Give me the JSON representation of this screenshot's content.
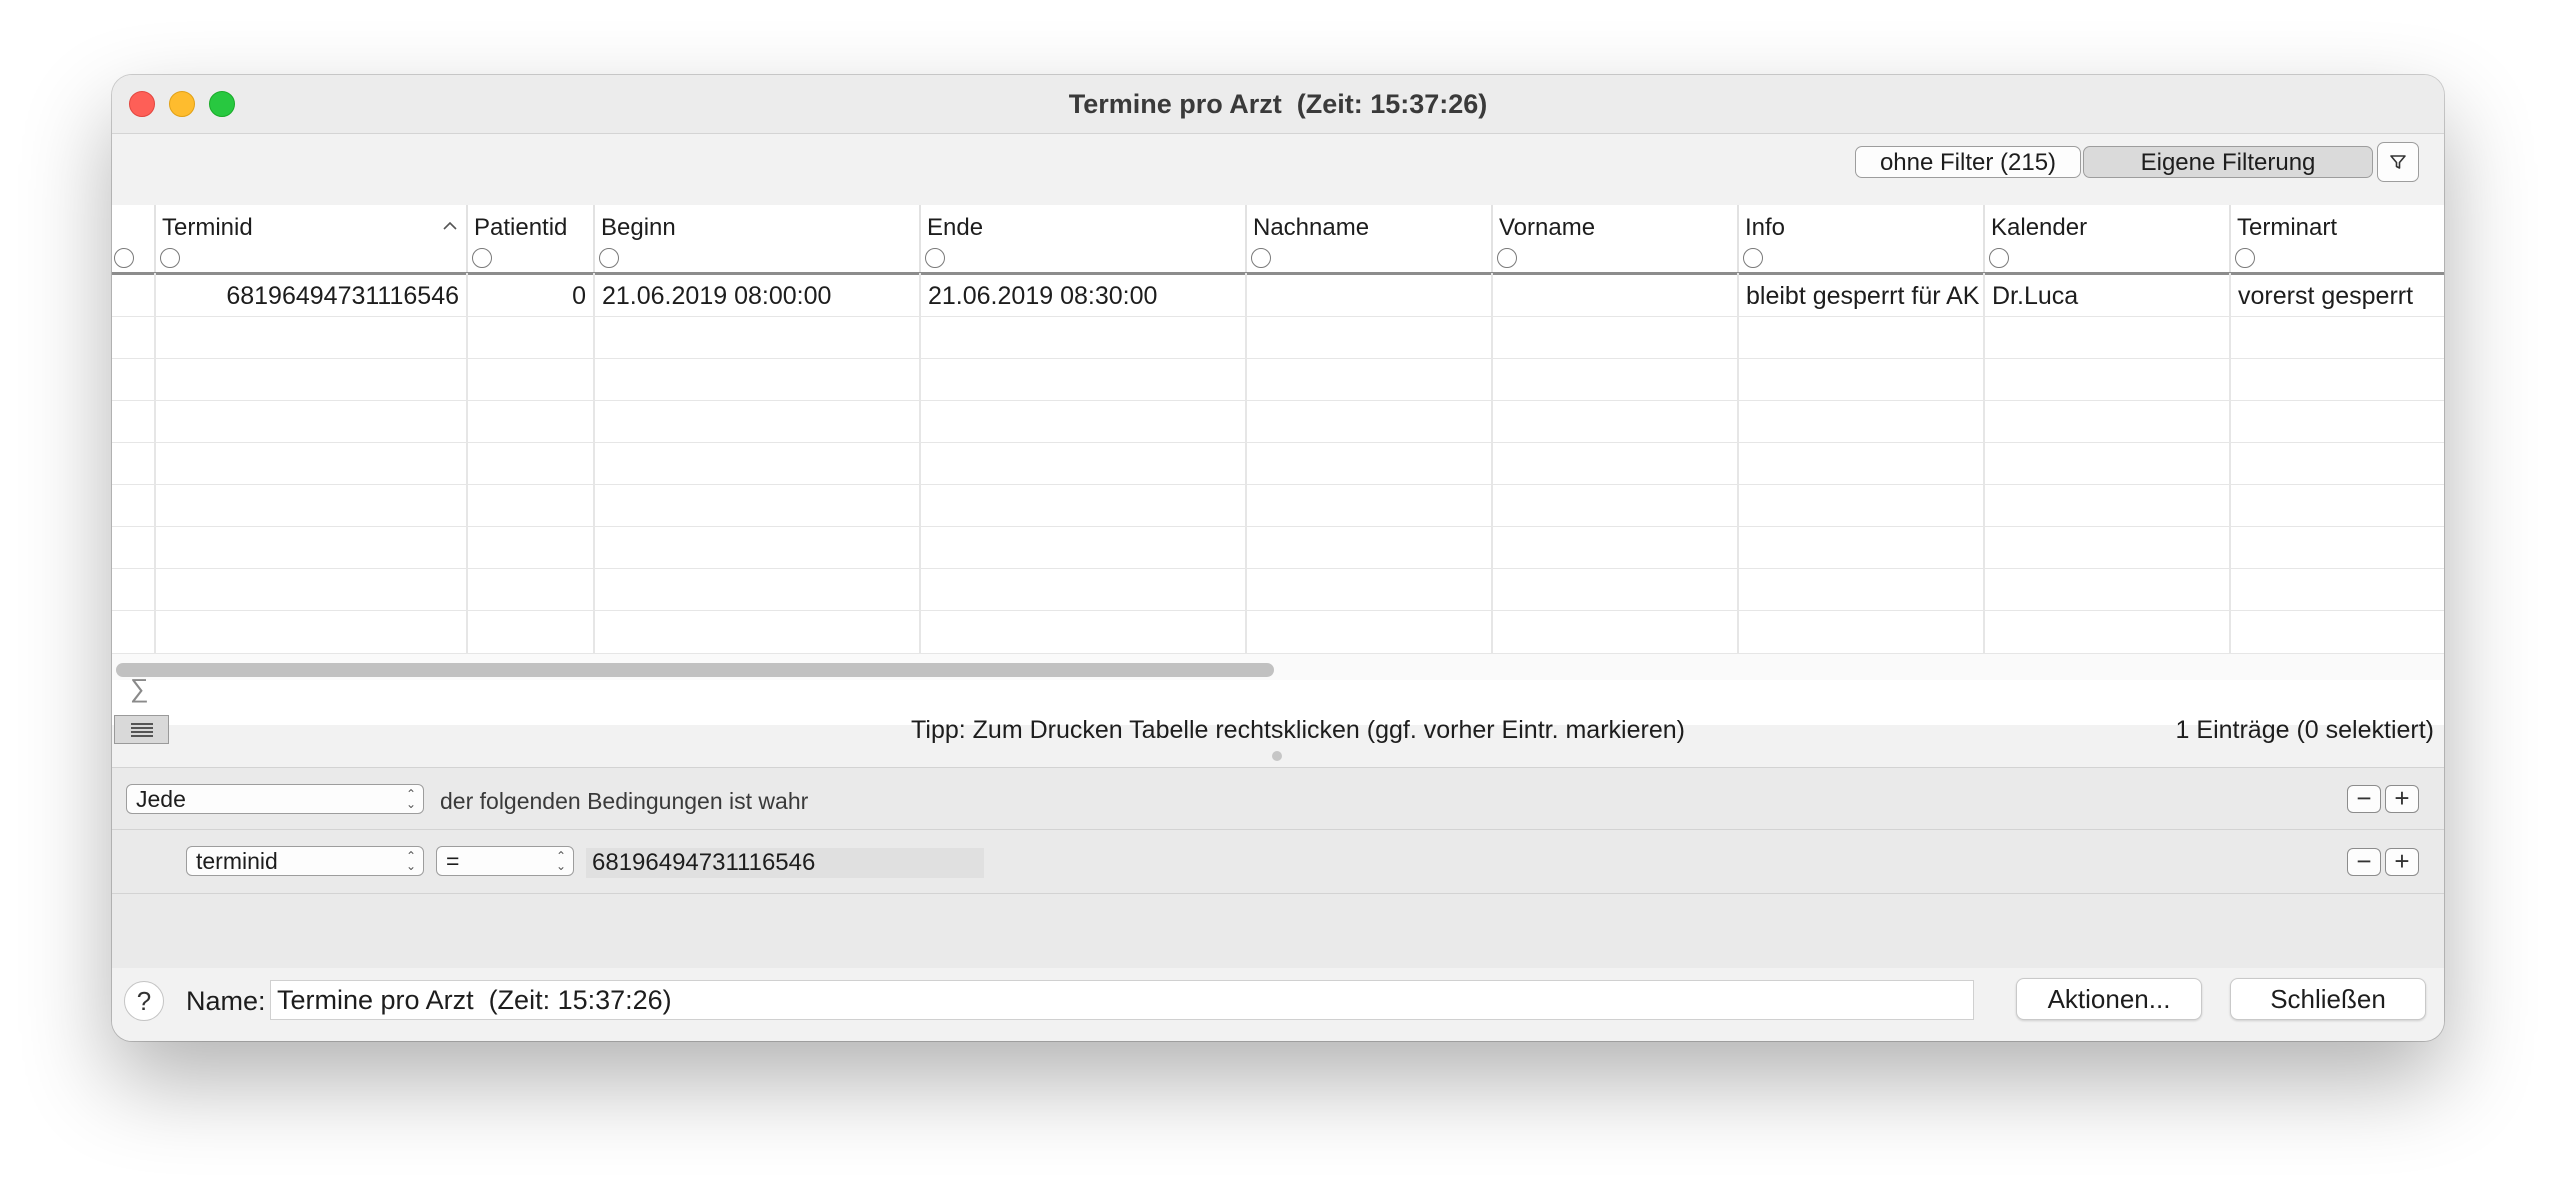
{
  "window": {
    "title": "Termine pro Arzt  (Zeit: 15:37:26)"
  },
  "toolbar": {
    "no_filter_label": "ohne Filter (215)",
    "custom_filter_label": "Eigene Filterung",
    "filter_icon": "funnel-icon"
  },
  "table": {
    "columns": [
      {
        "label": "Terminid",
        "sorted": "ascending"
      },
      {
        "label": "Patientid"
      },
      {
        "label": "Beginn"
      },
      {
        "label": "Ende"
      },
      {
        "label": "Nachname"
      },
      {
        "label": "Vorname"
      },
      {
        "label": "Info"
      },
      {
        "label": "Kalender"
      },
      {
        "label": "Terminart"
      }
    ],
    "rows": [
      [
        "68196494731116546",
        "0",
        "21.06.2019 08:00:00",
        "21.06.2019 08:30:00",
        "",
        "",
        "bleibt gesperrt für AK",
        "Dr.Luca",
        "vorerst gesperrt"
      ]
    ]
  },
  "status": {
    "sigma": "∑",
    "tip": "Tipp: Zum Drucken Tabelle rechtsklicken (ggf. vorher Eintr. markieren)",
    "count": "1 Einträge (0 selektiert)"
  },
  "conditions": {
    "match_select": "Jede",
    "match_text": "der folgenden Bedingungen ist wahr",
    "rule": {
      "field": "terminid",
      "operator": "=",
      "value": "68196494731116546"
    },
    "minus": "−",
    "plus": "+"
  },
  "footer": {
    "help": "?",
    "name_label": "Name:",
    "name_value": "Termine pro Arzt  (Zeit: 15:37:26)",
    "actions_label": "Aktionen...",
    "close_label": "Schließen"
  }
}
